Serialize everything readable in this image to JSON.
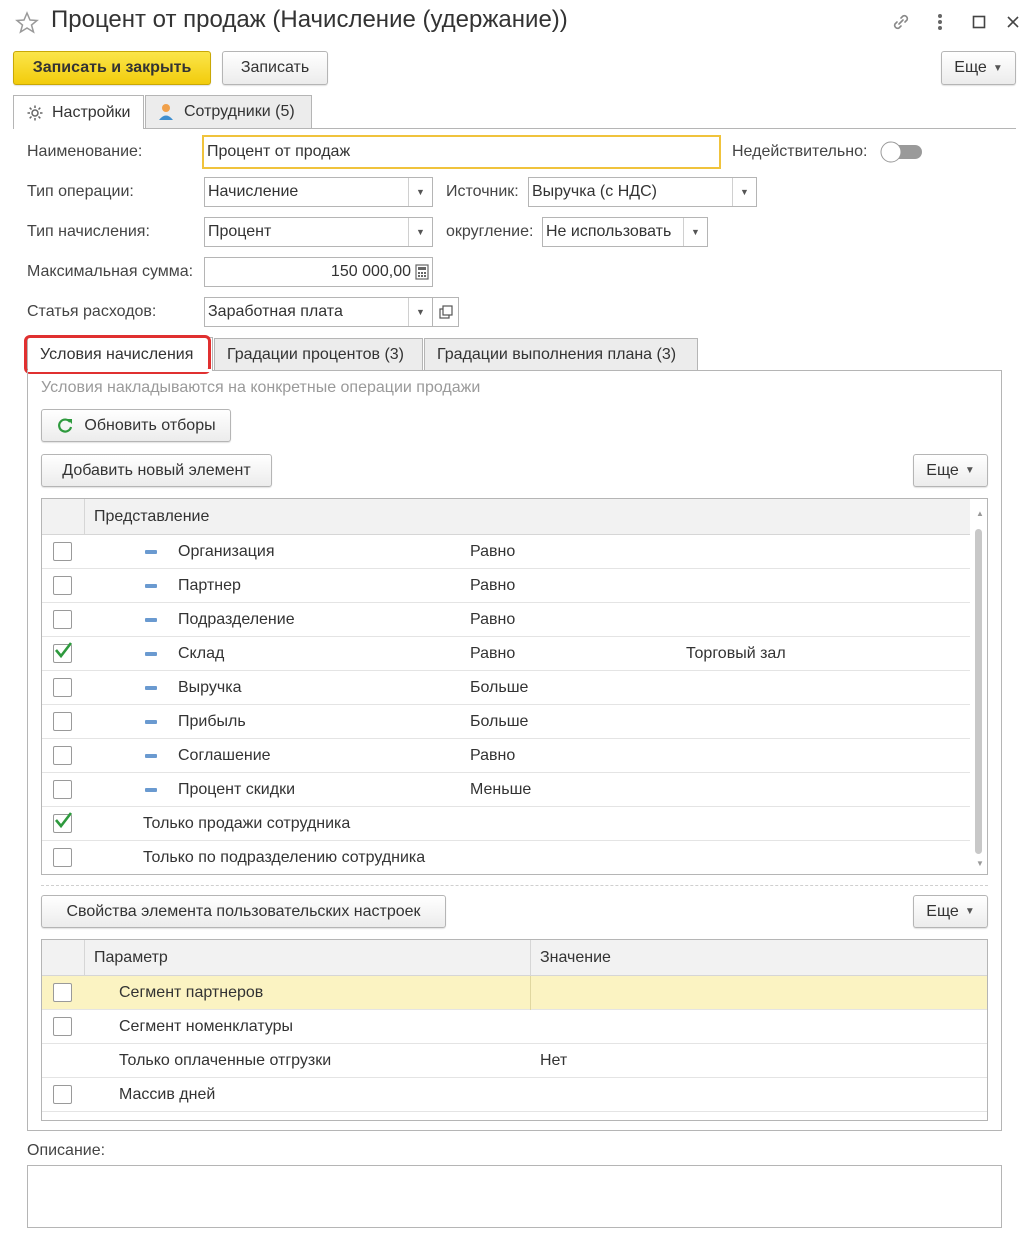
{
  "window": {
    "title": "Процент от продаж (Начисление (удержание))"
  },
  "toolbar": {
    "save_close": "Записать и закрыть",
    "save": "Записать",
    "more": "Еще"
  },
  "tabs": {
    "settings": "Настройки",
    "employees": "Сотрудники (5)"
  },
  "form": {
    "name_label": "Наименование:",
    "name_value": "Процент от продаж",
    "invalid_label": "Недействительно:",
    "op_type_label": "Тип операции:",
    "op_type_value": "Начисление",
    "source_label": "Источник:",
    "source_value": "Выручка (с НДС)",
    "accrual_type_label": "Тип начисления:",
    "accrual_type_value": "Процент",
    "rounding_label": "округление:",
    "rounding_value": "Не использовать",
    "max_sum_label": "Максимальная сумма:",
    "max_sum_value": "150 000,00",
    "expense_label": "Статья расходов:",
    "expense_value": "Заработная плата"
  },
  "subtabs": {
    "conditions": "Условия начисления",
    "gradations": "Градации процентов (3)",
    "plan_gradations": "Градации выполнения плана (3)"
  },
  "conditions": {
    "hint": "Условия накладываются на конкретные операции продажи",
    "refresh": "Обновить отборы",
    "add": "Добавить новый элемент",
    "more": "Еще",
    "header": "Представление",
    "rows": [
      {
        "name": "Организация",
        "cond": "Равно",
        "value": "",
        "checked": false,
        "indented": true
      },
      {
        "name": "Партнер",
        "cond": "Равно",
        "value": "",
        "checked": false,
        "indented": true
      },
      {
        "name": "Подразделение",
        "cond": "Равно",
        "value": "",
        "checked": false,
        "indented": true
      },
      {
        "name": "Склад",
        "cond": "Равно",
        "value": "Торговый зал",
        "checked": true,
        "indented": true
      },
      {
        "name": "Выручка",
        "cond": "Больше",
        "value": "",
        "checked": false,
        "indented": true
      },
      {
        "name": "Прибыль",
        "cond": "Больше",
        "value": "",
        "checked": false,
        "indented": true
      },
      {
        "name": "Соглашение",
        "cond": "Равно",
        "value": "",
        "checked": false,
        "indented": true
      },
      {
        "name": "Процент скидки",
        "cond": "Меньше",
        "value": "",
        "checked": false,
        "indented": true
      },
      {
        "name": "Только продажи сотрудника",
        "cond": "",
        "value": "",
        "checked": true,
        "indented": false
      },
      {
        "name": "Только по подразделению сотрудника",
        "cond": "",
        "value": "",
        "checked": false,
        "indented": false
      }
    ]
  },
  "props": {
    "button": "Свойства элемента пользовательских настроек",
    "more": "Еще",
    "col_param": "Параметр",
    "col_value": "Значение",
    "rows": [
      {
        "name": "Сегмент партнеров",
        "value": "",
        "checkbox": true,
        "selected": true
      },
      {
        "name": "Сегмент номенклатуры",
        "value": "",
        "checkbox": true,
        "selected": false
      },
      {
        "name": "Только оплаченные отгрузки",
        "value": "Нет",
        "checkbox": false,
        "selected": false
      },
      {
        "name": "Массив дней",
        "value": "",
        "checkbox": true,
        "selected": false
      }
    ]
  },
  "description": {
    "label": "Описание:"
  },
  "colors": {
    "accent_yellow": "#f4d01e",
    "highlight_red": "#e03030",
    "check_green": "#2e9a3e",
    "selected_row": "#fbf3c2"
  }
}
